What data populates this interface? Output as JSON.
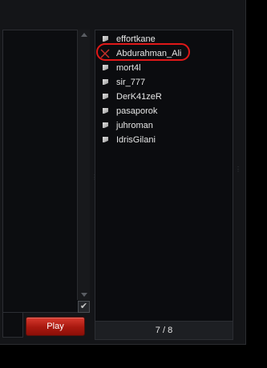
{
  "left_panel": {
    "play_button_label": "Play",
    "checkbox_checked": true
  },
  "player_panel": {
    "players": [
      {
        "name": "effortkane",
        "icon": "grey-flag-icon"
      },
      {
        "name": "Abdurahman_Ali",
        "icon": "kick-x-icon",
        "highlighted": true
      },
      {
        "name": "mort4l",
        "icon": "grey-flag-icon"
      },
      {
        "name": "sir_777",
        "icon": "grey-flag-icon"
      },
      {
        "name": "DerK41zeR",
        "icon": "grey-flag-icon"
      },
      {
        "name": "pasaporok",
        "icon": "grey-flag-icon"
      },
      {
        "name": "juhroman",
        "icon": "grey-flag-icon"
      },
      {
        "name": "IdrisGilani",
        "icon": "grey-flag-icon"
      }
    ],
    "count_label": "7 / 8"
  },
  "colors": {
    "accent_red": "#e01818",
    "play_button": "#b8201a"
  }
}
